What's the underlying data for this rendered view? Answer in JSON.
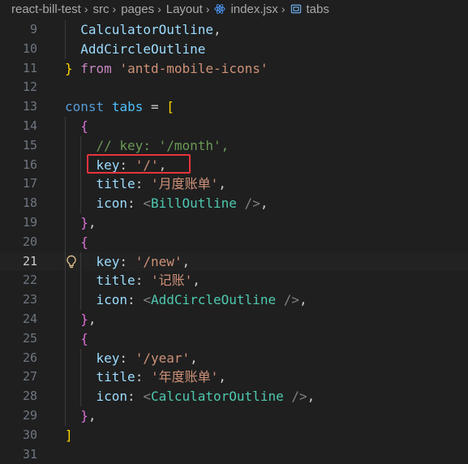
{
  "breadcrumb": {
    "project": "react-bill-test",
    "folder1": "src",
    "folder2": "pages",
    "folder3": "Layout",
    "file": "index.jsx",
    "symbol": "tabs"
  },
  "colors": {
    "background": "#1f1f1f",
    "highlight_box": "#e8333a",
    "string": "#ce9178",
    "property": "#9cdcfe",
    "component": "#4ec9b0",
    "keyword": "#569cd6",
    "comment": "#6a9955"
  },
  "active_line": 21,
  "lines": [
    {
      "n": "9",
      "t": [
        "CalculatorOutline",
        ","
      ]
    },
    {
      "n": "10",
      "t": [
        "AddCircleOutline"
      ]
    },
    {
      "n": "11",
      "t": [
        "}",
        " ",
        "from",
        " ",
        "'antd-mobile-icons'"
      ]
    },
    {
      "n": "12",
      "t": []
    },
    {
      "n": "13",
      "t": [
        "const",
        " ",
        "tabs",
        " = ",
        "["
      ]
    },
    {
      "n": "14",
      "t": [
        "{"
      ]
    },
    {
      "n": "15",
      "t": [
        "// key: '/month',"
      ]
    },
    {
      "n": "16",
      "t": [
        "key",
        ": ",
        "'/'",
        ","
      ]
    },
    {
      "n": "17",
      "t": [
        "title",
        ": ",
        "'月度账单'",
        ","
      ]
    },
    {
      "n": "18",
      "t": [
        "icon",
        ": ",
        "<",
        "BillOutline",
        " />",
        ","
      ]
    },
    {
      "n": "19",
      "t": [
        "}",
        ","
      ]
    },
    {
      "n": "20",
      "t": [
        "{"
      ]
    },
    {
      "n": "21",
      "t": [
        "key",
        ": ",
        "'/new'",
        ","
      ]
    },
    {
      "n": "22",
      "t": [
        "title",
        ": ",
        "'记账'",
        ","
      ]
    },
    {
      "n": "23",
      "t": [
        "icon",
        ": ",
        "<",
        "AddCircleOutline",
        " />",
        ","
      ]
    },
    {
      "n": "24",
      "t": [
        "}",
        ","
      ]
    },
    {
      "n": "25",
      "t": [
        "{"
      ]
    },
    {
      "n": "26",
      "t": [
        "key",
        ": ",
        "'/year'",
        ","
      ]
    },
    {
      "n": "27",
      "t": [
        "title",
        ": ",
        "'年度账单'",
        ","
      ]
    },
    {
      "n": "28",
      "t": [
        "icon",
        ": ",
        "<",
        "CalculatorOutline",
        " />",
        ","
      ]
    },
    {
      "n": "29",
      "t": [
        "}",
        ","
      ]
    },
    {
      "n": "30",
      "t": [
        "]"
      ]
    },
    {
      "n": "31",
      "t": []
    }
  ]
}
